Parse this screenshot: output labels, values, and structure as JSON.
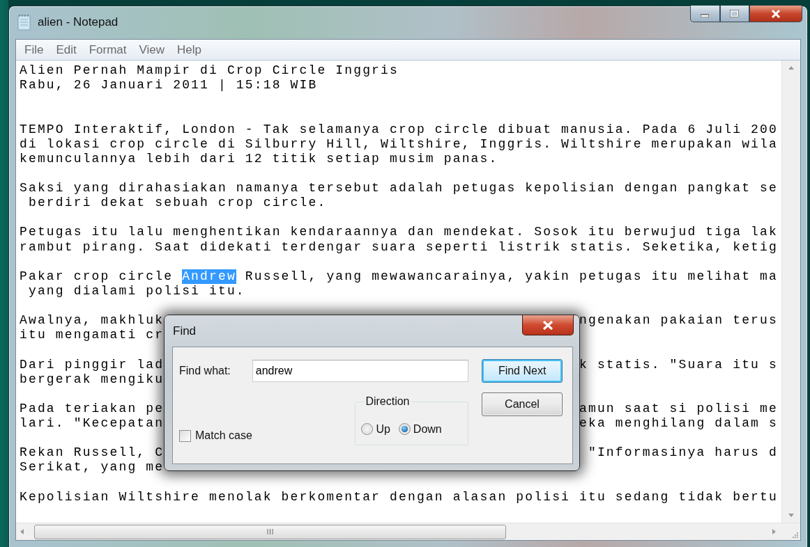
{
  "window": {
    "title": "alien - Notepad"
  },
  "menu": [
    "File",
    "Edit",
    "Format",
    "View",
    "Help"
  ],
  "document": {
    "lines": [
      {
        "kind": "text",
        "text": "Alien Pernah Mampir di Crop Circle Inggris"
      },
      {
        "kind": "text",
        "text": "Rabu, 26 Januari 2011 | 15:18 WIB"
      },
      {
        "kind": "blank"
      },
      {
        "kind": "blank"
      },
      {
        "kind": "text",
        "text": "TEMPO Interaktif, London - Tak selamanya crop circle dibuat manusia. Pada 6 Juli 200"
      },
      {
        "kind": "text",
        "text": "di lokasi crop circle di Silburry Hill, Wiltshire, Inggris. Wiltshire merupakan wila"
      },
      {
        "kind": "text",
        "text": "kemunculannya lebih dari 12 titik setiap musim panas."
      },
      {
        "kind": "blank"
      },
      {
        "kind": "text",
        "text": "Saksi yang dirahasiakan namanya tersebut adalah petugas kepolisian dengan pangkat se"
      },
      {
        "kind": "text",
        "text": " berdiri dekat sebuah crop circle."
      },
      {
        "kind": "blank"
      },
      {
        "kind": "text",
        "text": "Petugas itu lalu menghentikan kendaraannya dan mendekat. Sosok itu berwujud tiga lak"
      },
      {
        "kind": "text",
        "text": "rambut pirang. Saat didekati terdengar suara seperti listrik statis. Seketika, ketig"
      },
      {
        "kind": "blank"
      },
      {
        "kind": "selection",
        "before": "Pakar crop circle ",
        "selected": "Andrew",
        "after": " Russell, yang mewawancarainya, yakin petugas itu melihat ma"
      },
      {
        "kind": "text",
        "text": " yang dialami polisi itu."
      },
      {
        "kind": "blank"
      },
      {
        "kind": "split",
        "left": "Awalnya, makhluk",
        "right": "ngenakan pakaian terus"
      },
      {
        "kind": "text",
        "text": "itu mengamati cr"
      },
      {
        "kind": "blank"
      },
      {
        "kind": "split",
        "left": "Dari pinggir lad",
        "right": "k statis. \"Suara itu s"
      },
      {
        "kind": "text",
        "text": "bergerak mengiku"
      },
      {
        "kind": "blank"
      },
      {
        "kind": "split",
        "left": "Pada teriakan pe",
        "right": "amun saat si polisi me"
      },
      {
        "kind": "split",
        "left": "lari. \"Kecepatan",
        "right": "eka menghilang dalam s"
      },
      {
        "kind": "blank"
      },
      {
        "kind": "split",
        "left": "Rekan Russell, C",
        "right": "\"Informasinya harus d"
      },
      {
        "kind": "text",
        "text": "Serikat, yang me"
      },
      {
        "kind": "blank"
      },
      {
        "kind": "text",
        "text": "Kepolisian Wiltshire menolak berkomentar dengan alasan polisi itu sedang tidak bertu"
      }
    ]
  },
  "find_dialog": {
    "title": "Find",
    "find_what": {
      "label": "Find what:",
      "value": "andrew"
    },
    "match_case": {
      "label": "Match case",
      "checked": false
    },
    "direction": {
      "label": "Direction",
      "options": [
        {
          "label": "Up",
          "selected": false
        },
        {
          "label": "Down",
          "selected": true
        }
      ]
    },
    "buttons": [
      {
        "label": "Find Next",
        "default": true
      },
      {
        "label": "Cancel",
        "default": false
      }
    ]
  }
}
